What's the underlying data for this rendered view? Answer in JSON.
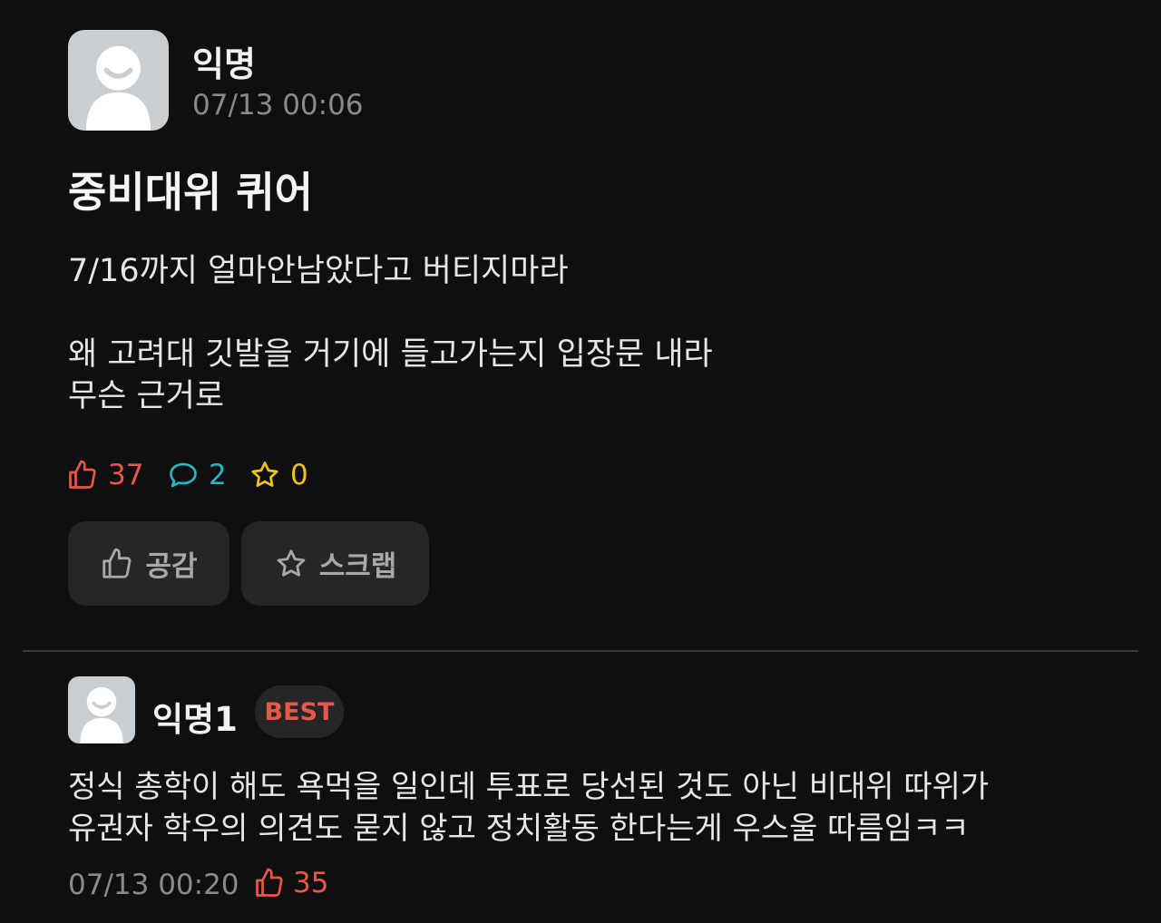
{
  "post": {
    "author": "익명",
    "time": "07/13 00:06",
    "title": "중비대위 퀴어",
    "body_lines": [
      "7/16까지 얼마안남았다고 버티지마라",
      "왜 고려대 깃발을 거기에 들고가는지 입장문 내라",
      "무슨 근거로"
    ],
    "likes": "37",
    "comments": "2",
    "scraps": "0"
  },
  "actions": {
    "like_label": "공감",
    "scrap_label": "스크랩"
  },
  "comment": {
    "author": "익명1",
    "badge": "BEST",
    "lines": [
      "정식 총학이 해도 욕먹을 일인데 투표로 당선된 것도 아닌 비대위 따위가",
      "유권자 학우의 의견도 묻지 않고 정치활동 한다는게 우스울 따름임ㅋㅋ"
    ],
    "time": "07/13 00:20",
    "likes": "35"
  },
  "colors": {
    "background": "#0f0f0f",
    "like": "#e8584a",
    "comment": "#2bb3c6",
    "scrap": "#f2c21b",
    "button_bg": "#262626"
  },
  "icons": [
    "avatar-icon",
    "thumbs-up-icon",
    "speech-bubble-icon",
    "star-icon"
  ]
}
